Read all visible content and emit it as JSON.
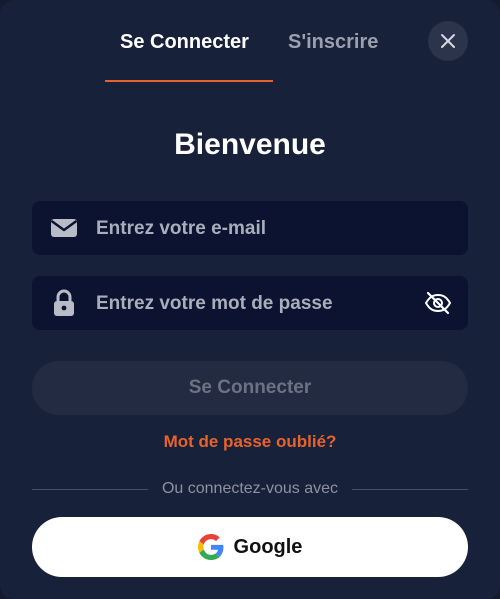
{
  "tabs": {
    "login": "Se Connecter",
    "signup": "S'inscrire"
  },
  "title": "Bienvenue",
  "email": {
    "placeholder": "Entrez votre e-mail",
    "icon": "envelope-icon"
  },
  "password": {
    "placeholder": "Entrez votre mot de passe",
    "icon": "lock-icon",
    "toggle_icon": "eye-slash-icon"
  },
  "submit_label": "Se Connecter",
  "forgot_label": "Mot de passe oublié?",
  "divider_label": "Ou connectez-vous avec",
  "google_label": "Google",
  "colors": {
    "background": "#18213a",
    "accent": "#e8632b",
    "field_bg": "#0b1330",
    "button_disabled_bg": "#232b43",
    "google_bg": "#ffffff"
  }
}
